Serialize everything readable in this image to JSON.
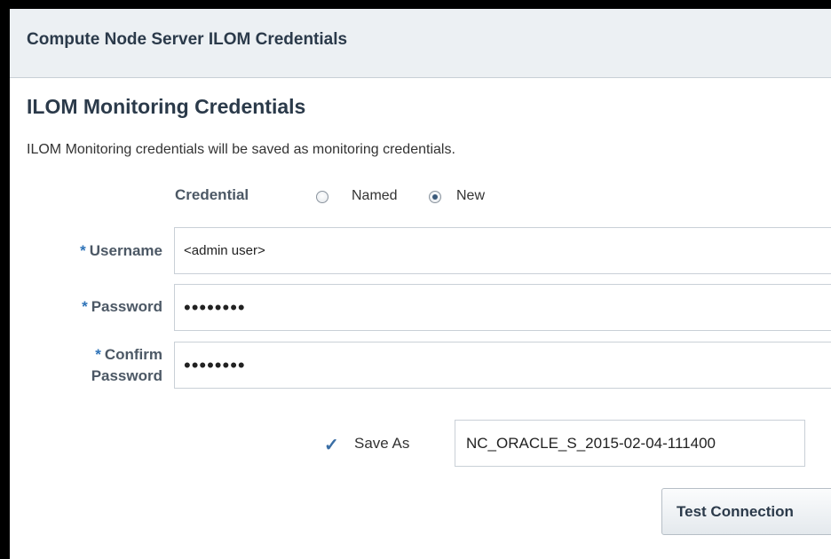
{
  "header": {
    "title": "Compute Node Server ILOM Credentials"
  },
  "section": {
    "title": "ILOM Monitoring Credentials",
    "description": "ILOM Monitoring credentials will be saved as monitoring credentials."
  },
  "credential": {
    "label": "Credential",
    "options": [
      {
        "label": "Named",
        "selected": false
      },
      {
        "label": "New",
        "selected": true
      }
    ]
  },
  "fields": {
    "username": {
      "label": "Username",
      "required": true,
      "value": "<admin user>"
    },
    "password": {
      "label": "Password",
      "required": true,
      "value": "••••••••"
    },
    "confirm_password": {
      "label_line1": "Confirm",
      "label_line2": "Password",
      "required": true,
      "value": "••••••••"
    }
  },
  "save_as": {
    "checked": true,
    "label": "Save As",
    "value": "NC_ORACLE_S_2015-02-04-111400"
  },
  "buttons": {
    "test_connection": "Test Connection"
  },
  "colors": {
    "header_bg": "#ecf0f3",
    "title_text": "#2b3a4a",
    "required_star": "#2e73b8",
    "checkmark": "#3a6ea5"
  }
}
